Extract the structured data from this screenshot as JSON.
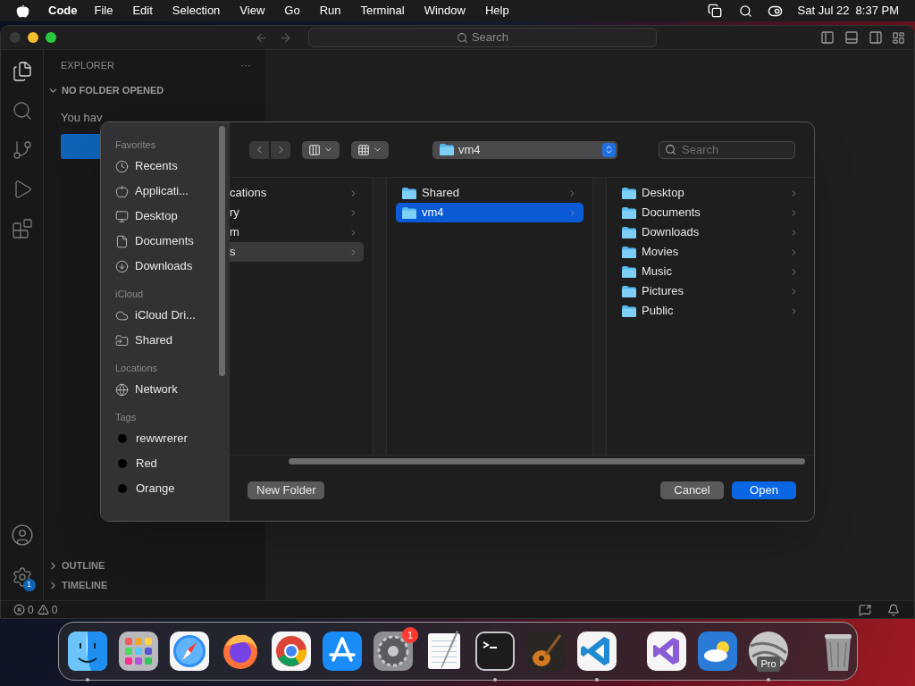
{
  "menubar": {
    "app": "Code",
    "menus": [
      "File",
      "Edit",
      "Selection",
      "View",
      "Go",
      "Run",
      "Terminal",
      "Window",
      "Help"
    ],
    "clock": "Sat Jul 22  8:37 PM"
  },
  "titlebar": {
    "search": "Search"
  },
  "activity": [
    {
      "kind": "files",
      "selected": true
    },
    {
      "kind": "search",
      "selected": false
    },
    {
      "kind": "scm",
      "selected": false
    },
    {
      "kind": "debug",
      "selected": false
    },
    {
      "kind": "extensions",
      "selected": false
    }
  ],
  "settings_badge": "1",
  "explorer": {
    "title": "EXPLORER",
    "more": "···",
    "section": "NO FOLDER OPENED",
    "message": "You hav",
    "panels": [
      {
        "label": "OUTLINE",
        "expanded": false
      },
      {
        "label": "TIMELINE",
        "expanded": false
      }
    ]
  },
  "status": {
    "errors": "0",
    "warnings": "0"
  },
  "dialog": {
    "sidebar": [
      {
        "heading": "Favorites",
        "items": [
          {
            "label": "Recents",
            "kind": "recents"
          },
          {
            "label": "Applicati...",
            "kind": "applications"
          },
          {
            "label": "Desktop",
            "kind": "desktop"
          },
          {
            "label": "Documents",
            "kind": "documents"
          },
          {
            "label": "Downloads",
            "kind": "downloads"
          }
        ]
      },
      {
        "heading": "iCloud",
        "items": [
          {
            "label": "iCloud Dri...",
            "kind": "cloud"
          },
          {
            "label": "Shared",
            "kind": "shared"
          }
        ]
      },
      {
        "heading": "Locations",
        "items": [
          {
            "label": "Network",
            "kind": "network"
          }
        ]
      },
      {
        "heading": "Tags",
        "items": [
          {
            "label": "rewwrerer",
            "kind": "tag",
            "color": "#000000"
          },
          {
            "label": "Red",
            "kind": "tag",
            "color": "#000000"
          },
          {
            "label": "Orange",
            "kind": "tag",
            "color": "#000000"
          }
        ]
      }
    ],
    "location": "vm4",
    "search_placeholder": "Search",
    "columns": [
      {
        "focused": false,
        "icons": false,
        "items": [
          {
            "label": "cations",
            "selected": false
          },
          {
            "label": "ry",
            "selected": false
          },
          {
            "label": "m",
            "selected": false
          },
          {
            "label": "s",
            "selected": true
          }
        ]
      },
      {
        "focused": true,
        "icons": true,
        "items": [
          {
            "label": "Shared",
            "selected": false
          },
          {
            "label": "vm4",
            "selected": true
          }
        ]
      },
      {
        "icons": true,
        "items": [
          {
            "label": "Desktop",
            "selected": false
          },
          {
            "label": "Documents",
            "selected": false
          },
          {
            "label": "Downloads",
            "selected": false
          },
          {
            "label": "Movies",
            "selected": false
          },
          {
            "label": "Music",
            "selected": false
          },
          {
            "label": "Pictures",
            "selected": false
          },
          {
            "label": "Public",
            "selected": false
          }
        ]
      }
    ],
    "new_folder": "New Folder",
    "cancel": "Cancel",
    "open": "Open"
  },
  "dock": [
    {
      "kind": "finder",
      "running": true
    },
    {
      "kind": "launchpad",
      "running": false
    },
    {
      "kind": "safari",
      "running": false
    },
    {
      "kind": "firefox",
      "running": false
    },
    {
      "kind": "chrome",
      "running": false
    },
    {
      "kind": "appstore",
      "running": false
    },
    {
      "kind": "settings",
      "running": false,
      "badge": "1"
    },
    {
      "kind": "textedit",
      "running": false
    },
    {
      "kind": "terminal",
      "running": true
    },
    {
      "kind": "guitar",
      "running": false
    },
    {
      "kind": "vscode",
      "running": true
    },
    {
      "kind": "divider"
    },
    {
      "kind": "vstudio",
      "running": false
    },
    {
      "kind": "weather",
      "running": false
    },
    {
      "kind": "earth",
      "running": true,
      "label": "Pro"
    },
    {
      "kind": "divider"
    },
    {
      "kind": "trash",
      "running": false
    }
  ]
}
